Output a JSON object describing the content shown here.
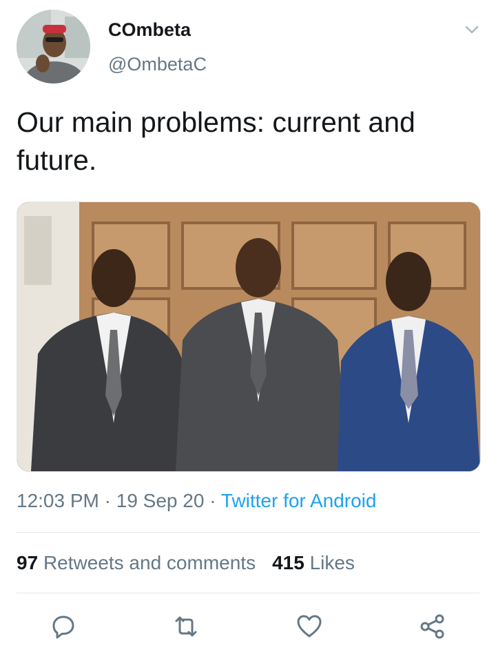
{
  "user": {
    "display_name": "COmbeta",
    "handle": "@OmbetaC"
  },
  "tweet": {
    "text": "Our main problems: current and future."
  },
  "meta": {
    "time": "12:03 PM",
    "separator": " · ",
    "date": "19 Sep 20",
    "source": "Twitter for Android"
  },
  "stats": {
    "retweets_count": "97",
    "retweets_label": "Retweets and comments",
    "likes_count": "415",
    "likes_label": "Likes"
  },
  "icons": {
    "menu": "chevron-down-icon",
    "reply": "comment-icon",
    "retweet": "retweet-icon",
    "like": "heart-icon",
    "share": "share-icon"
  },
  "colors": {
    "link": "#1da1f2",
    "secondary_text": "#657786",
    "primary_text": "#14171a",
    "divider": "#e1e8ed"
  }
}
